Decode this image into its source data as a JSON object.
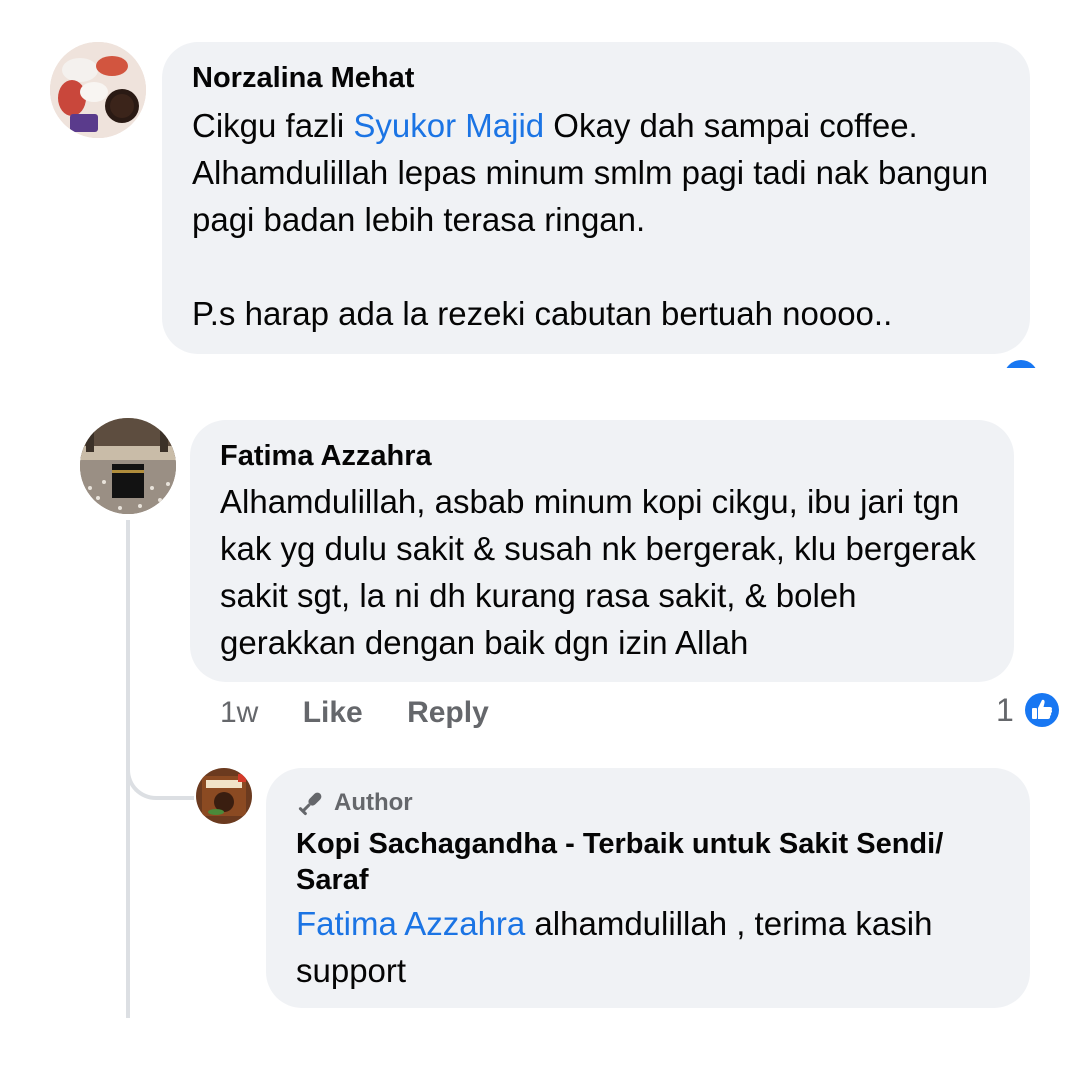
{
  "comments": [
    {
      "author": "Norzalina Mehat",
      "mention": "Syukor Majid",
      "text_before": "Cikgu fazli ",
      "text_after": " Okay dah sampai coffee. Alhamdulillah lepas minum smlm pagi tadi nak bangun pagi badan lebih terasa ringan.\n\nP.s harap ada la rezeki cabutan bertuah noooo.."
    },
    {
      "author": "Fatima Azzahra",
      "text": "Alhamdulillah, asbab minum kopi cikgu, ibu jari tgn kak yg dulu sakit & susah nk bergerak, klu bergerak sakit sgt, la ni dh kurang rasa sakit, & boleh gerakkan dengan baik dgn izin Allah",
      "time": "1w",
      "like_label": "Like",
      "reply_label": "Reply",
      "reaction_count": "1"
    },
    {
      "badge": "Author",
      "author": "Kopi Sachagandha - Terbaik untuk Sakit Sendi/ Saraf",
      "mention": "Fatima Azzahra",
      "text_after": " alhamdulillah , terima kasih support"
    }
  ],
  "colors": {
    "bubble": "#f0f2f5",
    "mention": "#1b74e4",
    "like_blue": "#1877f2",
    "meta_gray": "#65676b"
  }
}
